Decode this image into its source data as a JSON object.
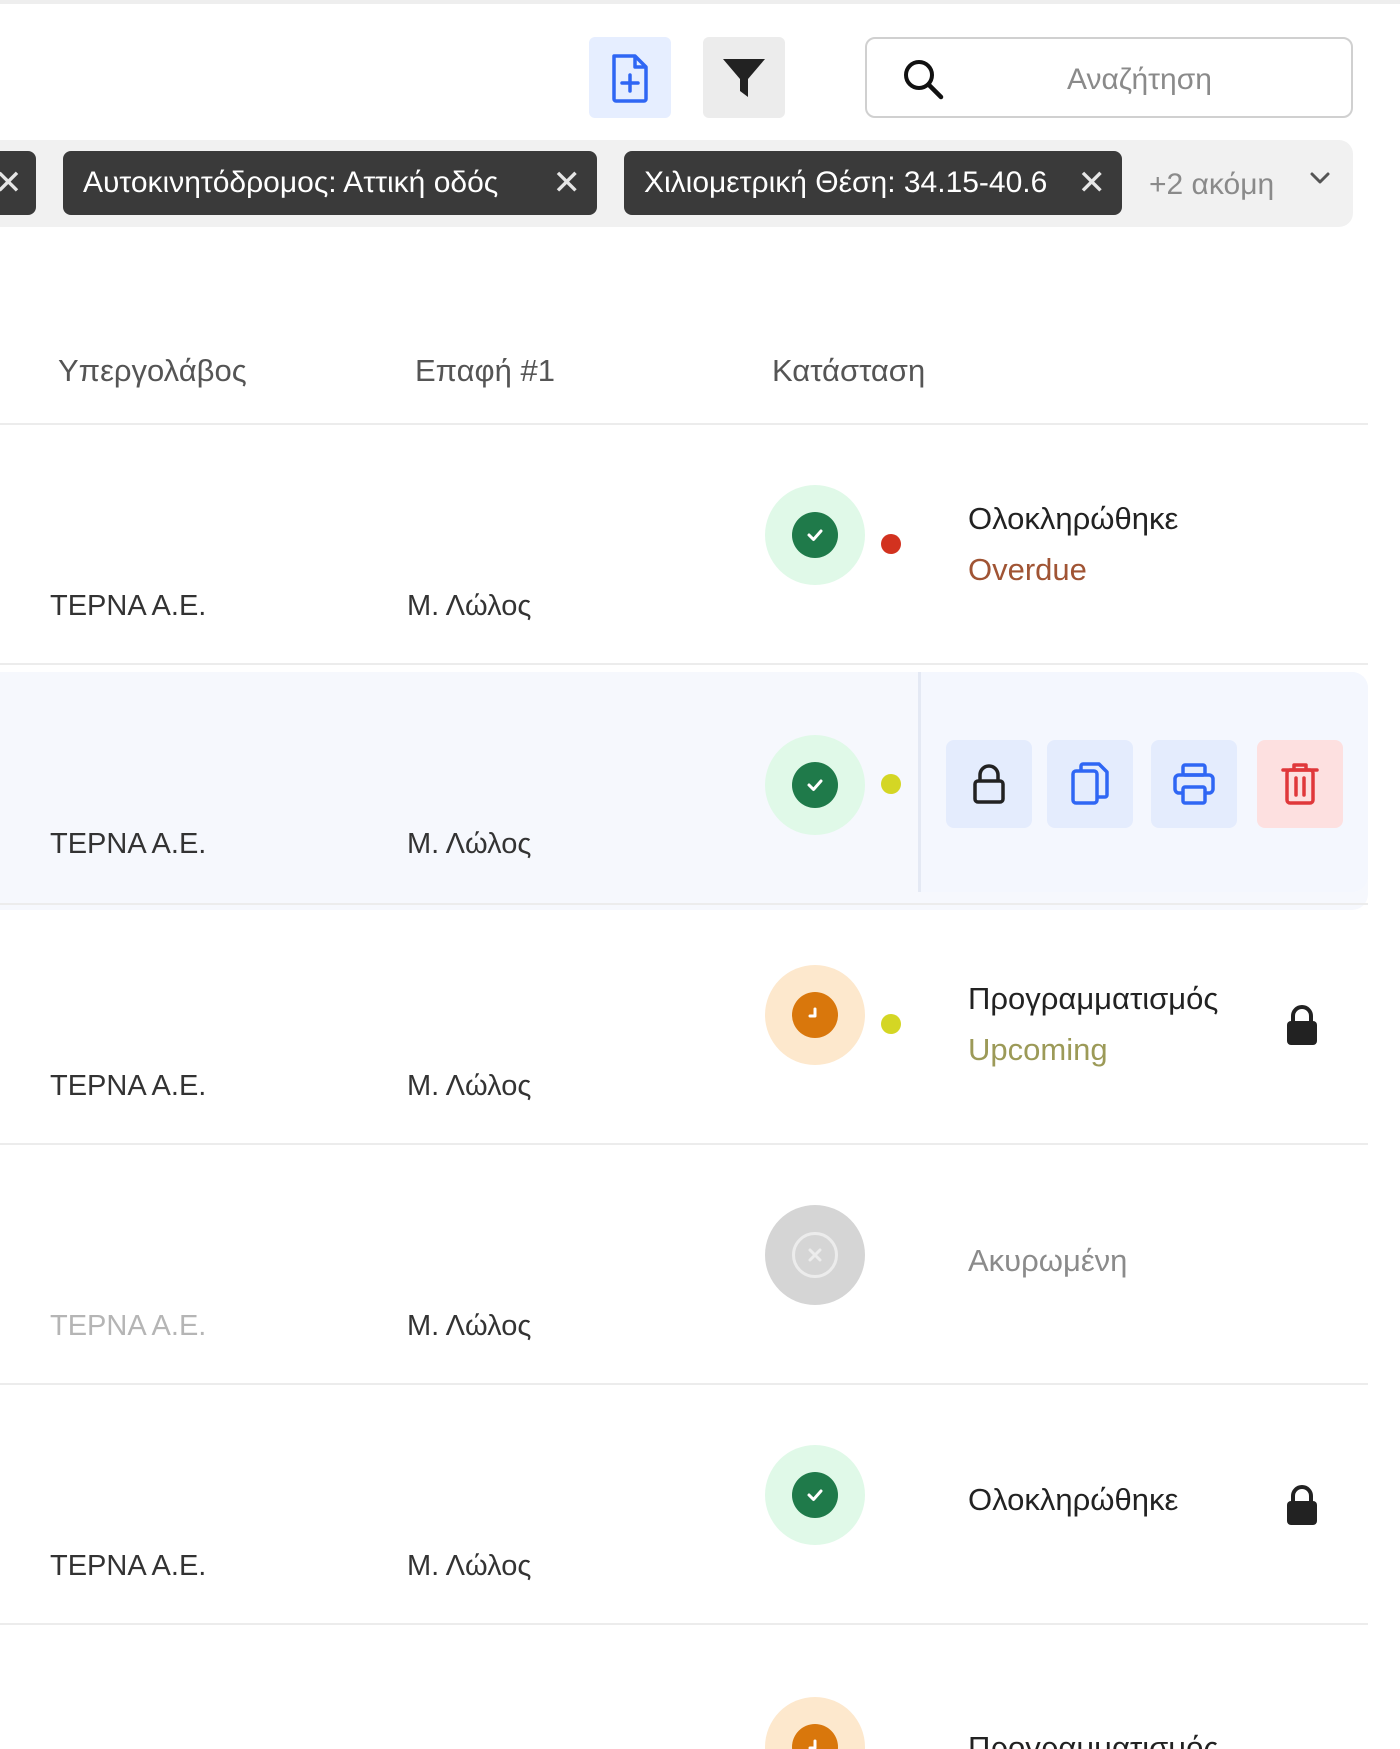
{
  "toolbar": {
    "new_icon": "file-plus-icon",
    "filter_icon": "filter-icon",
    "search_placeholder": "Αναζήτηση",
    "accent": "#2f66f4"
  },
  "filters": {
    "chips": [
      {
        "label": "Αυτοκινητόδρομος: Αττική οδός"
      },
      {
        "label": "Χιλιομετρική Θέση: 34.15-40.6"
      }
    ],
    "more_label": "+2 ακόμη"
  },
  "table": {
    "headers": {
      "subcontractor": "Υπεργολάβος",
      "contact": "Επαφή #1",
      "status": "Κατάσταση"
    },
    "rows": [
      {
        "subcontractor": "ΤΕΡΝΑ Α.Ε.",
        "contact": "Μ. Λώλος",
        "status": "Ολοκληρώθηκε",
        "due": "Overdue",
        "status_color": "green",
        "dot": "red",
        "locked": false
      },
      {
        "subcontractor": "ΤΕΡΝΑ Α.Ε.",
        "contact": "Μ. Λώλος",
        "status_color": "green",
        "dot": "yellow",
        "hovered": true
      },
      {
        "subcontractor": "ΤΕΡΝΑ Α.Ε.",
        "contact": "Μ. Λώλος",
        "status": "Προγραμματισμός",
        "due": "Upcoming",
        "status_color": "orange",
        "dot": "yellow",
        "locked": true
      },
      {
        "subcontractor": "ΤΕΡΝΑ Α.Ε.",
        "contact": "Μ. Λώλος",
        "status": "Ακυρωμένη",
        "status_color": "grey",
        "locked": false
      },
      {
        "subcontractor": "ΤΕΡΝΑ Α.Ε.",
        "contact": "Μ. Λώλος",
        "status": "Ολοκληρώθηκε",
        "status_color": "green",
        "locked": true
      },
      {
        "subcontractor": "",
        "contact": "",
        "status": "Προγραμματισμός",
        "status_color": "orange",
        "locked": false
      }
    ],
    "row_actions": [
      "lock-icon",
      "copy-icon",
      "print-icon",
      "delete-icon"
    ]
  },
  "colors": {
    "green": "#1f7a4a",
    "orange": "#d9770c",
    "overdue": "#a05434",
    "upcoming": "#9c9a58",
    "delete": "#e0383b"
  }
}
